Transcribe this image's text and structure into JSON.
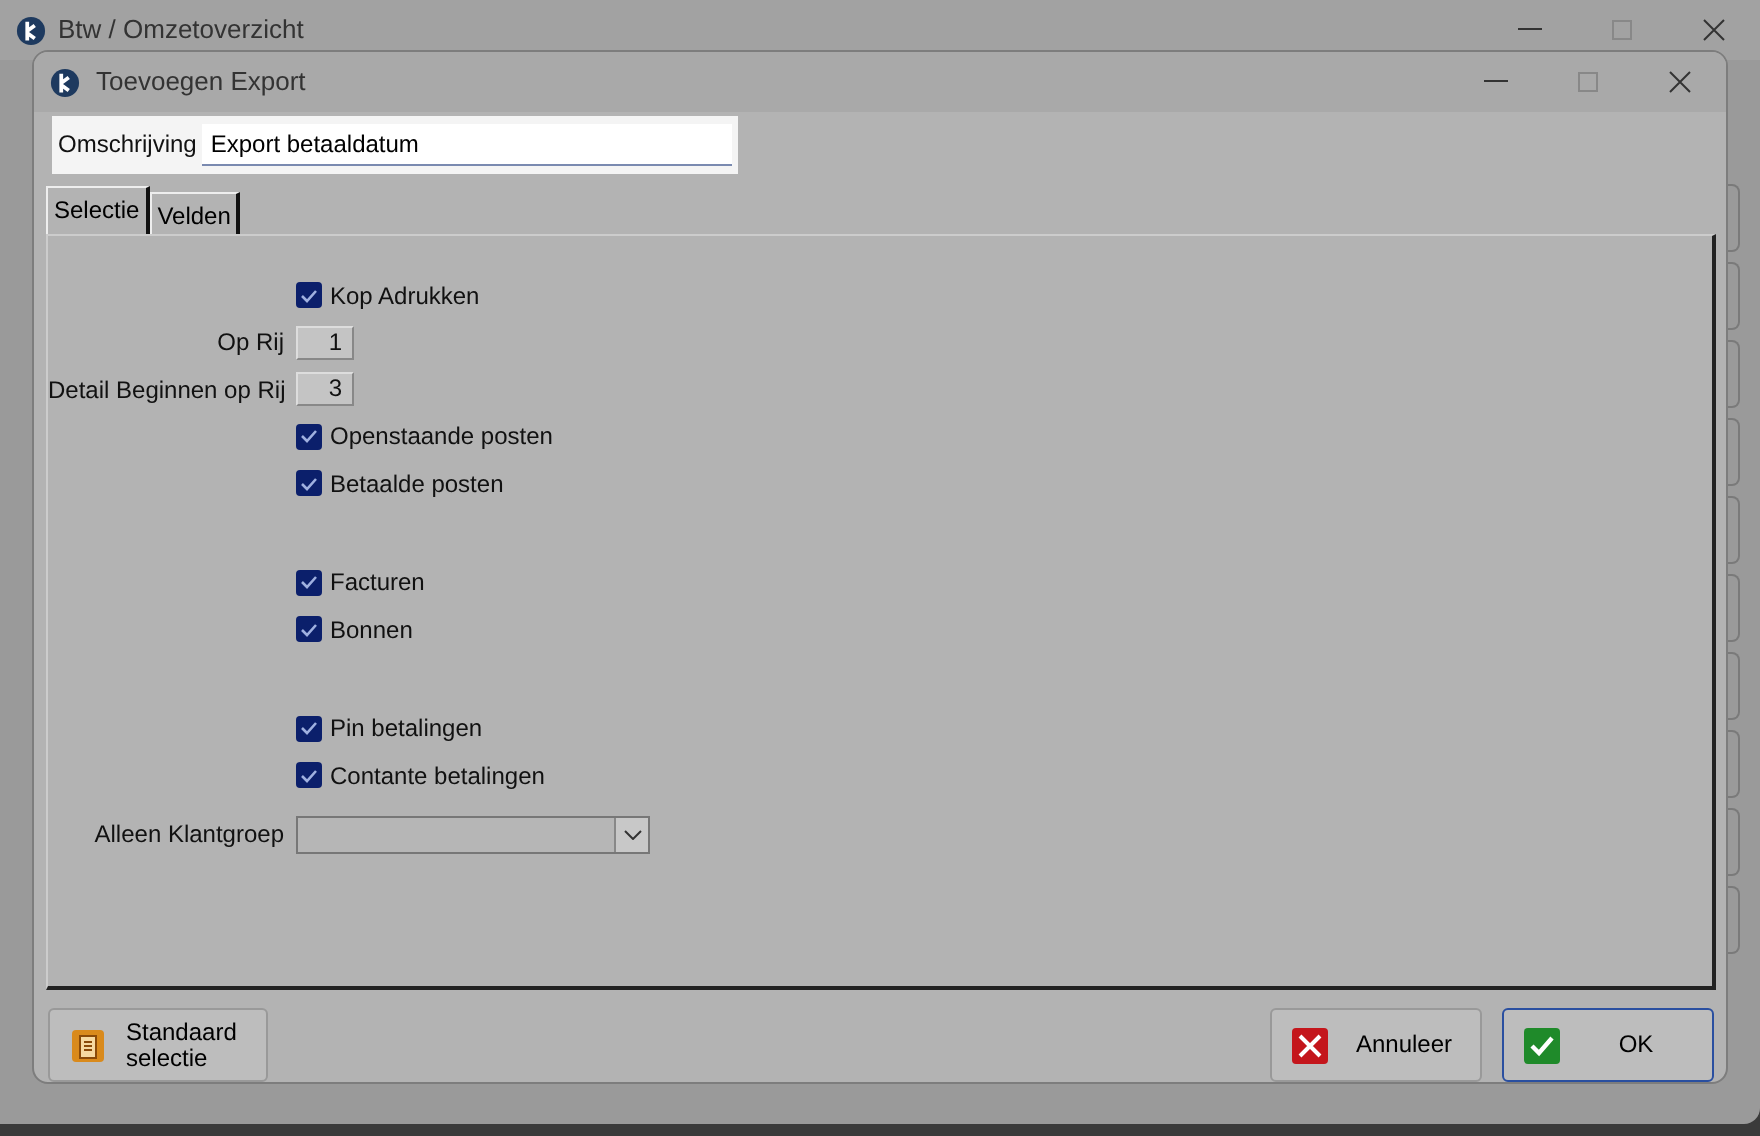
{
  "window": {
    "title": "Btw / Omzetoverzicht"
  },
  "dialog": {
    "title": "Toevoegen Export",
    "description": {
      "label": "Omschrijving",
      "value": "Export betaaldatum"
    },
    "tabs": [
      {
        "label": "Selectie",
        "selected": true
      },
      {
        "label": "Velden",
        "selected": false
      }
    ],
    "groups": [
      [
        {
          "kind": "checkbox",
          "label": "Kop Adrukken",
          "checked": true
        },
        {
          "kind": "number",
          "label": "Op Rij",
          "value": "1"
        },
        {
          "kind": "number",
          "label": "Detail Beginnen op Rij",
          "value": "3"
        },
        {
          "kind": "checkbox",
          "label": "Openstaande posten",
          "checked": true
        },
        {
          "kind": "checkbox",
          "label": "Betaalde posten",
          "checked": true
        }
      ],
      [
        {
          "kind": "checkbox",
          "label": "Facturen",
          "checked": true
        },
        {
          "kind": "checkbox",
          "label": "Bonnen",
          "checked": true
        }
      ],
      [
        {
          "kind": "checkbox",
          "label": "Pin betalingen",
          "checked": true
        },
        {
          "kind": "checkbox",
          "label": "Contante betalingen",
          "checked": true
        },
        {
          "kind": "select",
          "label": "Alleen Klantgroep"
        }
      ]
    ],
    "buttons": [
      {
        "kind": "standard",
        "label": "Standaard selectie"
      },
      {
        "kind": "cancel",
        "label": "Annuleer"
      },
      {
        "kind": "ok",
        "label": "OK"
      }
    ]
  }
}
